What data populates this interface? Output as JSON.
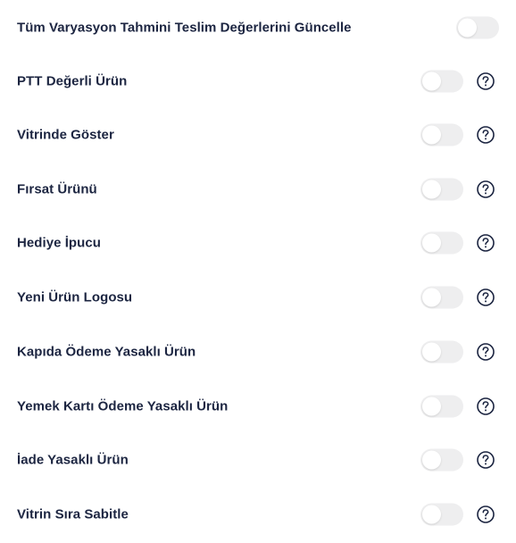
{
  "settings": {
    "master_toggle": {
      "label": "Tüm Varyasyon Tahmini Teslim Değerlerini Güncelle",
      "enabled": false
    },
    "items": [
      {
        "label": "PTT Değerli Ürün",
        "enabled": false,
        "icon": "help-icon"
      },
      {
        "label": "Vitrinde Göster",
        "enabled": false,
        "icon": "help-icon"
      },
      {
        "label": "Fırsat Ürünü",
        "enabled": false,
        "icon": "help-icon"
      },
      {
        "label": "Hediye İpucu",
        "enabled": false,
        "icon": "help-icon"
      },
      {
        "label": "Yeni Ürün Logosu",
        "enabled": false,
        "icon": "help-icon"
      },
      {
        "label": "Kapıda Ödeme Yasaklı Ürün",
        "enabled": false,
        "icon": "help-icon"
      },
      {
        "label": "Yemek Kartı Ödeme Yasaklı Ürün",
        "enabled": false,
        "icon": "help-icon"
      },
      {
        "label": "İade Yasaklı Ürün",
        "enabled": false,
        "icon": "help-icon"
      },
      {
        "label": "Vitrin Sıra Sabitle",
        "enabled": false,
        "icon": "help-icon"
      }
    ]
  },
  "colors": {
    "text": "#1c2541",
    "toggle_off": "#eeeeef",
    "icon": "#1c2541"
  }
}
